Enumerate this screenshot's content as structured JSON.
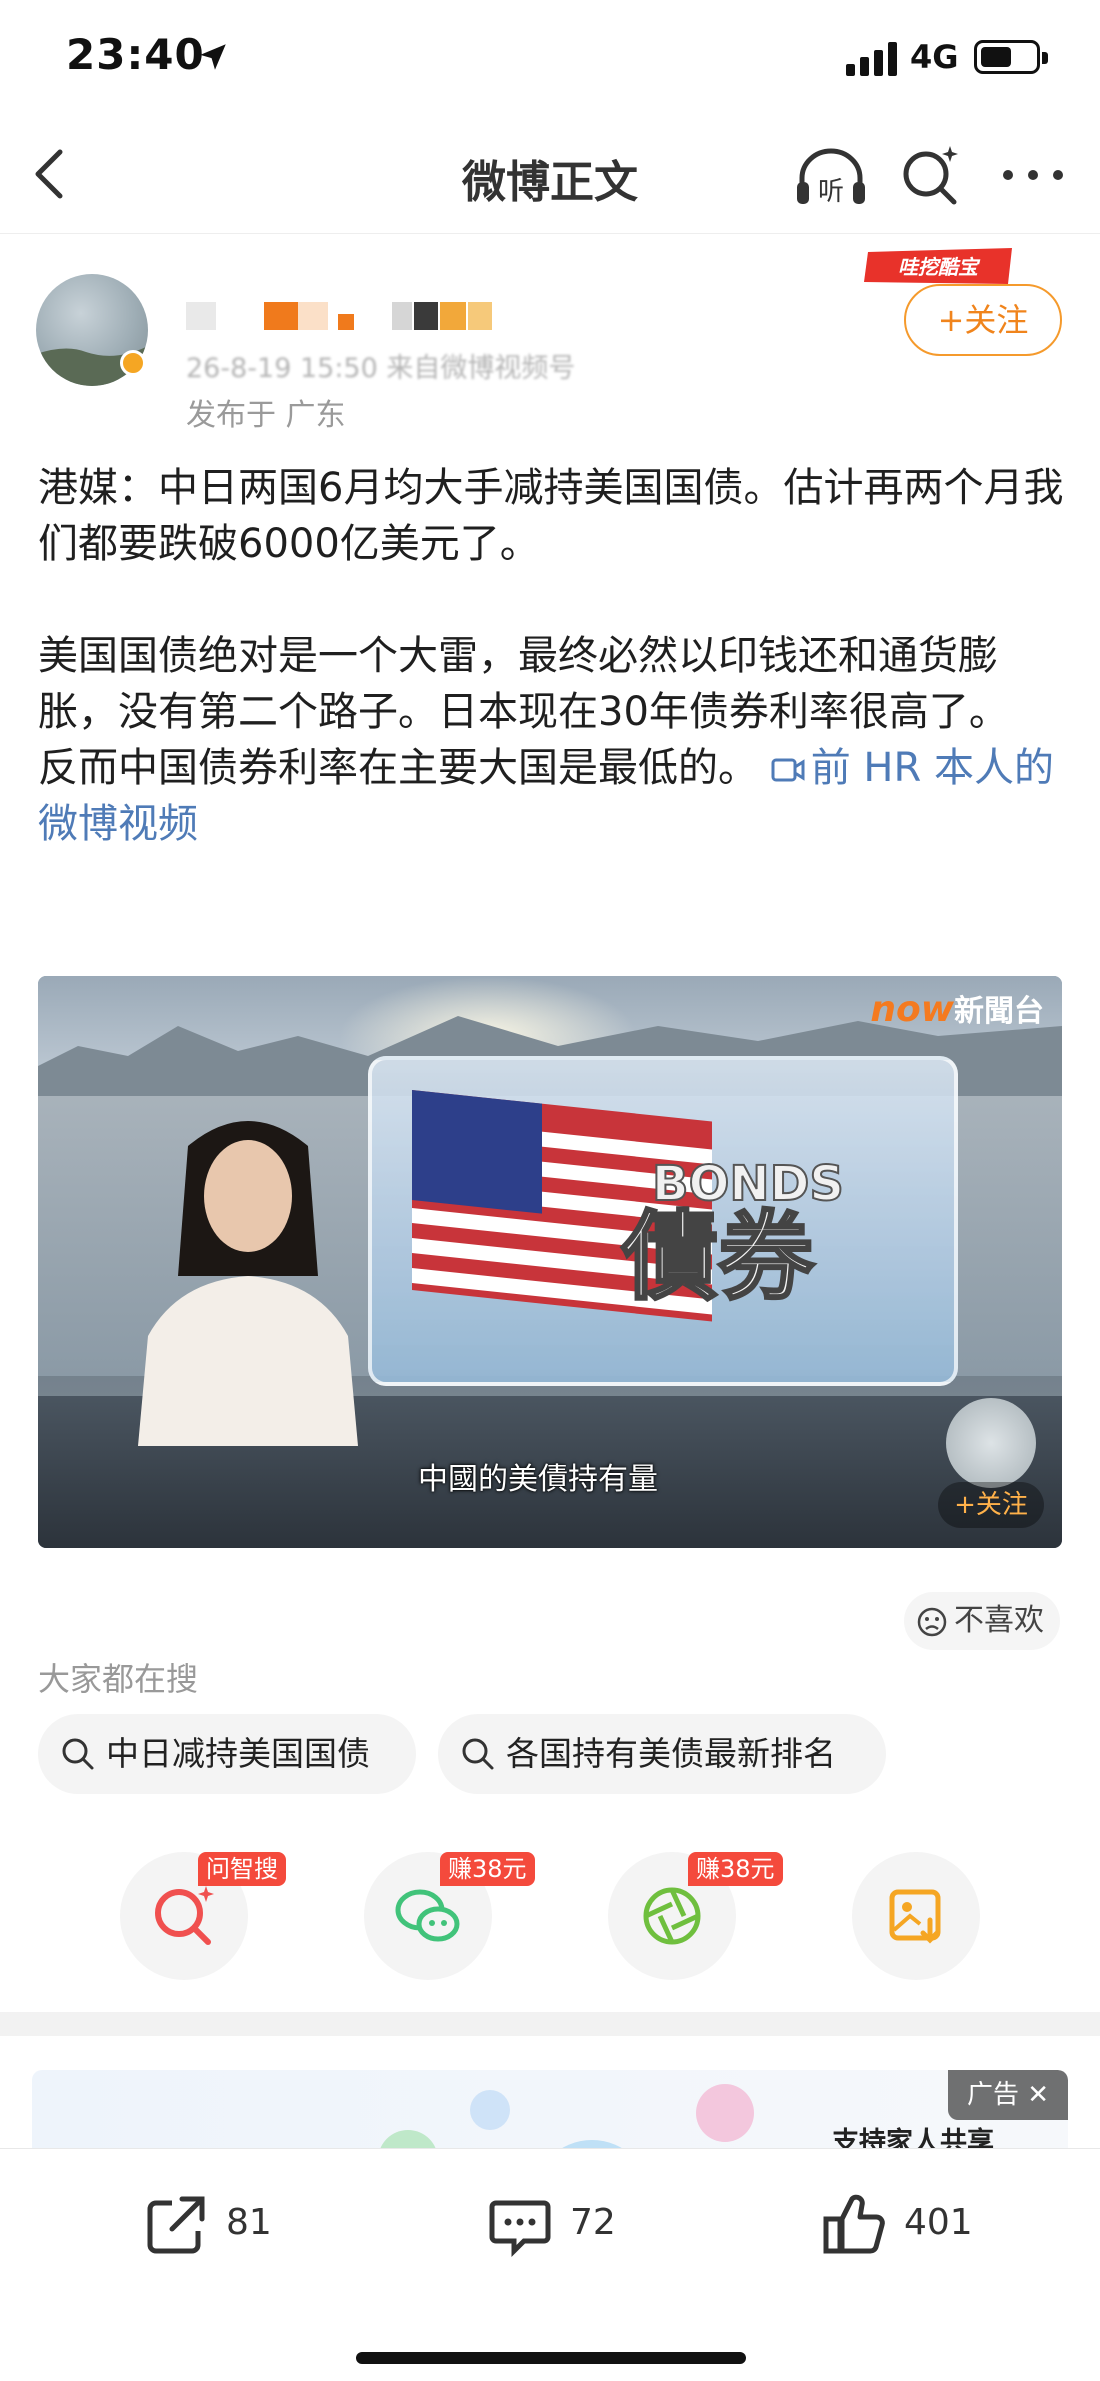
{
  "status_bar": {
    "time": "23:40",
    "network": "4G"
  },
  "nav": {
    "title": "微博正文"
  },
  "post": {
    "meta": "26-8-19 15:50 来自微博视频号",
    "location": "发布于 广东",
    "promo_badge": "哇挖酷宝",
    "follow_label": "+关注",
    "paragraph1": "港媒：中日两国6月均大手减持美国国债。估计再两个月我们都要跌破6000亿美元了。",
    "paragraph2": "美国国债绝对是一个大雷，最终必然以印钱还和通货膨胀，没有第二个路子。日本现在30年债券利率很高了。",
    "paragraph3": "反而中国债券利率在主要大国是最低的。",
    "video_link": "前 HR 本人的微博视频"
  },
  "video": {
    "channel_logo_now": "now",
    "channel_logo_text": "新聞台",
    "panel_en": "BONDS",
    "panel_cn": "債券",
    "subtitle": "中國的美債持有量",
    "follow_label": "+关注"
  },
  "dislike_label": "不喜欢",
  "search": {
    "heading": "大家都在搜",
    "chips": [
      "中日减持美国国债",
      "各国持有美债最新排名"
    ]
  },
  "share": [
    {
      "name": "ask-search",
      "tag": "问智搜",
      "color": "#f0504f"
    },
    {
      "name": "wechat",
      "tag": "赚38元",
      "color": "#41c37a"
    },
    {
      "name": "moments",
      "tag": "赚38元",
      "color": "#6fbf3e"
    },
    {
      "name": "save-image",
      "tag": "",
      "color": "#f5a623"
    }
  ],
  "ad": {
    "tag": "广告",
    "text": "支持家人共享"
  },
  "actions": {
    "repost": "81",
    "comments": "72",
    "likes": "401"
  }
}
